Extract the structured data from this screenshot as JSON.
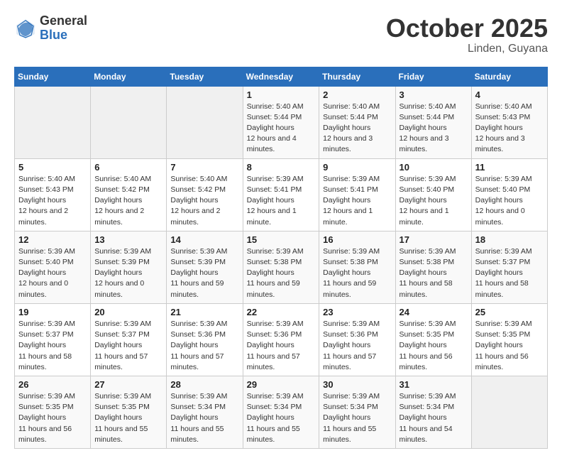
{
  "header": {
    "logo_general": "General",
    "logo_blue": "Blue",
    "month_title": "October 2025",
    "location": "Linden, Guyana"
  },
  "weekdays": [
    "Sunday",
    "Monday",
    "Tuesday",
    "Wednesday",
    "Thursday",
    "Friday",
    "Saturday"
  ],
  "weeks": [
    [
      {
        "day": "",
        "empty": true
      },
      {
        "day": "",
        "empty": true
      },
      {
        "day": "",
        "empty": true
      },
      {
        "day": "1",
        "sunrise": "5:40 AM",
        "sunset": "5:44 PM",
        "daylight": "12 hours and 4 minutes."
      },
      {
        "day": "2",
        "sunrise": "5:40 AM",
        "sunset": "5:44 PM",
        "daylight": "12 hours and 3 minutes."
      },
      {
        "day": "3",
        "sunrise": "5:40 AM",
        "sunset": "5:44 PM",
        "daylight": "12 hours and 3 minutes."
      },
      {
        "day": "4",
        "sunrise": "5:40 AM",
        "sunset": "5:43 PM",
        "daylight": "12 hours and 3 minutes."
      }
    ],
    [
      {
        "day": "5",
        "sunrise": "5:40 AM",
        "sunset": "5:43 PM",
        "daylight": "12 hours and 2 minutes."
      },
      {
        "day": "6",
        "sunrise": "5:40 AM",
        "sunset": "5:42 PM",
        "daylight": "12 hours and 2 minutes."
      },
      {
        "day": "7",
        "sunrise": "5:40 AM",
        "sunset": "5:42 PM",
        "daylight": "12 hours and 2 minutes."
      },
      {
        "day": "8",
        "sunrise": "5:39 AM",
        "sunset": "5:41 PM",
        "daylight": "12 hours and 1 minute."
      },
      {
        "day": "9",
        "sunrise": "5:39 AM",
        "sunset": "5:41 PM",
        "daylight": "12 hours and 1 minute."
      },
      {
        "day": "10",
        "sunrise": "5:39 AM",
        "sunset": "5:40 PM",
        "daylight": "12 hours and 1 minute."
      },
      {
        "day": "11",
        "sunrise": "5:39 AM",
        "sunset": "5:40 PM",
        "daylight": "12 hours and 0 minutes."
      }
    ],
    [
      {
        "day": "12",
        "sunrise": "5:39 AM",
        "sunset": "5:40 PM",
        "daylight": "12 hours and 0 minutes."
      },
      {
        "day": "13",
        "sunrise": "5:39 AM",
        "sunset": "5:39 PM",
        "daylight": "12 hours and 0 minutes."
      },
      {
        "day": "14",
        "sunrise": "5:39 AM",
        "sunset": "5:39 PM",
        "daylight": "11 hours and 59 minutes."
      },
      {
        "day": "15",
        "sunrise": "5:39 AM",
        "sunset": "5:38 PM",
        "daylight": "11 hours and 59 minutes."
      },
      {
        "day": "16",
        "sunrise": "5:39 AM",
        "sunset": "5:38 PM",
        "daylight": "11 hours and 59 minutes."
      },
      {
        "day": "17",
        "sunrise": "5:39 AM",
        "sunset": "5:38 PM",
        "daylight": "11 hours and 58 minutes."
      },
      {
        "day": "18",
        "sunrise": "5:39 AM",
        "sunset": "5:37 PM",
        "daylight": "11 hours and 58 minutes."
      }
    ],
    [
      {
        "day": "19",
        "sunrise": "5:39 AM",
        "sunset": "5:37 PM",
        "daylight": "11 hours and 58 minutes."
      },
      {
        "day": "20",
        "sunrise": "5:39 AM",
        "sunset": "5:37 PM",
        "daylight": "11 hours and 57 minutes."
      },
      {
        "day": "21",
        "sunrise": "5:39 AM",
        "sunset": "5:36 PM",
        "daylight": "11 hours and 57 minutes."
      },
      {
        "day": "22",
        "sunrise": "5:39 AM",
        "sunset": "5:36 PM",
        "daylight": "11 hours and 57 minutes."
      },
      {
        "day": "23",
        "sunrise": "5:39 AM",
        "sunset": "5:36 PM",
        "daylight": "11 hours and 57 minutes."
      },
      {
        "day": "24",
        "sunrise": "5:39 AM",
        "sunset": "5:35 PM",
        "daylight": "11 hours and 56 minutes."
      },
      {
        "day": "25",
        "sunrise": "5:39 AM",
        "sunset": "5:35 PM",
        "daylight": "11 hours and 56 minutes."
      }
    ],
    [
      {
        "day": "26",
        "sunrise": "5:39 AM",
        "sunset": "5:35 PM",
        "daylight": "11 hours and 56 minutes."
      },
      {
        "day": "27",
        "sunrise": "5:39 AM",
        "sunset": "5:35 PM",
        "daylight": "11 hours and 55 minutes."
      },
      {
        "day": "28",
        "sunrise": "5:39 AM",
        "sunset": "5:34 PM",
        "daylight": "11 hours and 55 minutes."
      },
      {
        "day": "29",
        "sunrise": "5:39 AM",
        "sunset": "5:34 PM",
        "daylight": "11 hours and 55 minutes."
      },
      {
        "day": "30",
        "sunrise": "5:39 AM",
        "sunset": "5:34 PM",
        "daylight": "11 hours and 55 minutes."
      },
      {
        "day": "31",
        "sunrise": "5:39 AM",
        "sunset": "5:34 PM",
        "daylight": "11 hours and 54 minutes."
      },
      {
        "day": "",
        "empty": true
      }
    ]
  ]
}
